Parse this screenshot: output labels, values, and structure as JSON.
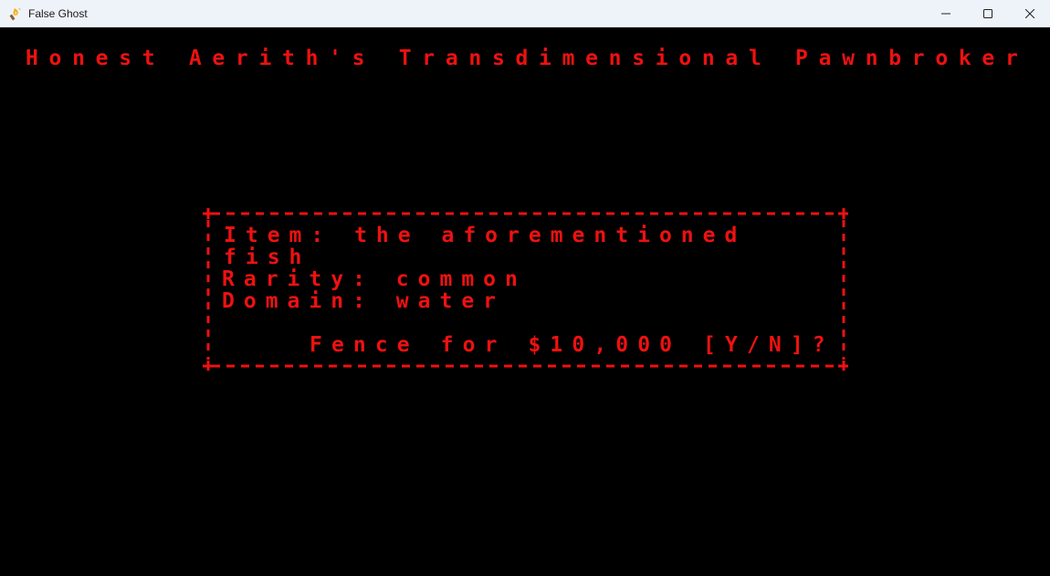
{
  "window": {
    "title": "False Ghost",
    "icon": "torch-icon",
    "controls": {
      "minimize": "minimize-icon",
      "maximize": "maximize-icon",
      "close": "close-icon"
    }
  },
  "screen": {
    "text_color": "#ee1111",
    "background": "#000000",
    "shop_title": "Honest Aerith's Transdimensional Pawnbroker",
    "dialog": {
      "item_line": "Item: the aforementioned",
      "item_line_cont": "fish",
      "rarity_line": "Rarity: common",
      "domain_line": "Domain: water",
      "prompt": "Fence for $10,000 [Y/N]?"
    }
  }
}
